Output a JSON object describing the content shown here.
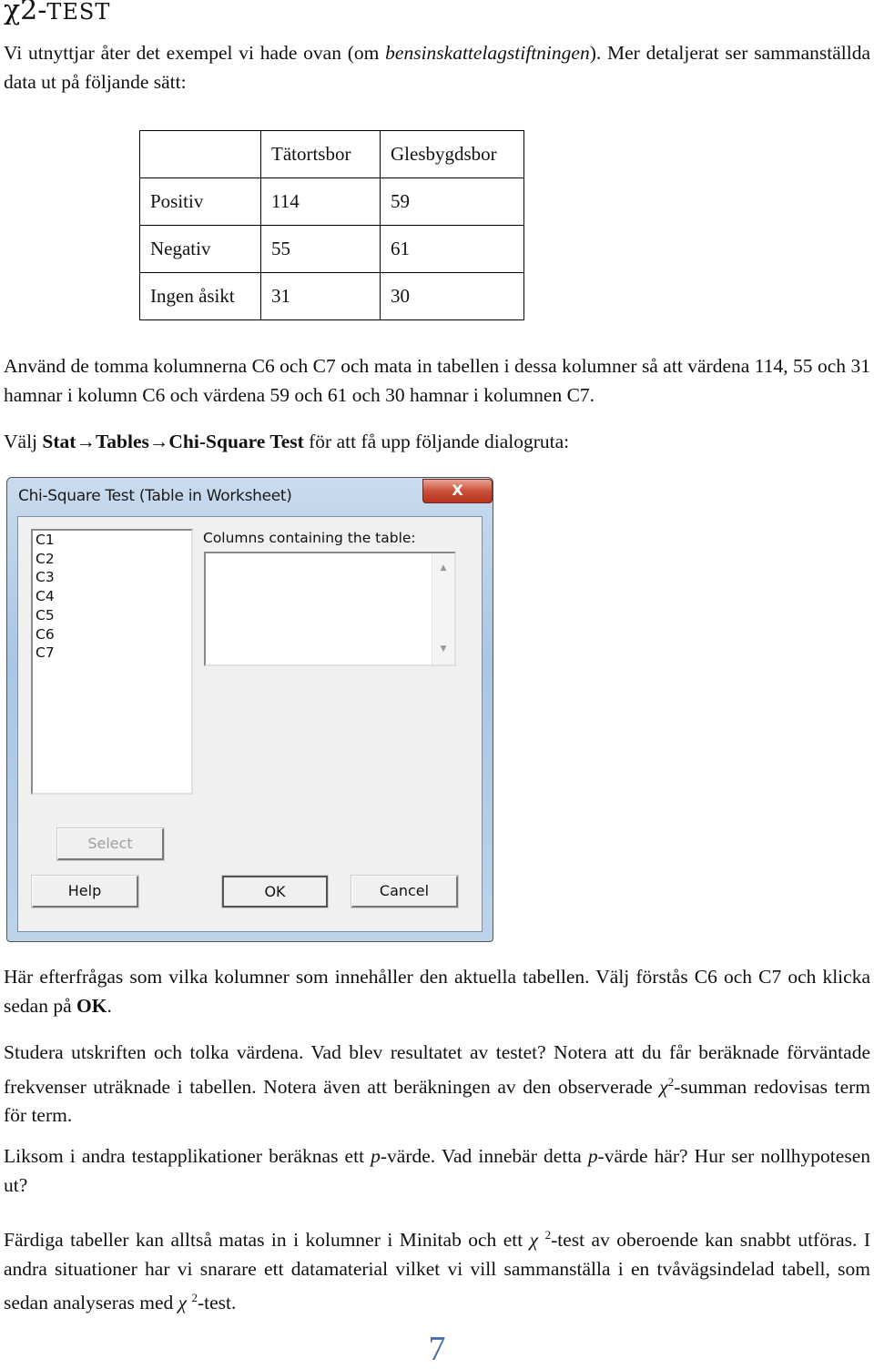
{
  "heading": {
    "chi": "χ2-",
    "word": "TEST"
  },
  "para1": {
    "before": "Vi utnyttjar åter det exempel vi hade ovan (om ",
    "italic": "bensinskattelagstiftningen",
    "after": "). Mer detaljerat ser sammanställda data ut på följande sätt:"
  },
  "table": {
    "headers": [
      "",
      "Tätortsbor",
      "Glesbygdsbor"
    ],
    "rows": [
      [
        "Positiv",
        "114",
        "59"
      ],
      [
        "Negativ",
        "55",
        "61"
      ],
      [
        "Ingen åsikt",
        "31",
        "30"
      ]
    ]
  },
  "para2": "Använd de tomma kolumnerna C6 och C7 och mata in tabellen i dessa kolumner så att värdena 114, 55 och 31 hamnar i kolumn C6 och värdena 59 och 61 och 30 hamnar i kolumnen C7.",
  "para3": {
    "before": "Välj ",
    "menu1": "Stat",
    "arrow": "→",
    "menu2": "Tables",
    "menu3": "Chi-Square Test",
    "after": " för att få upp följande dialogruta:"
  },
  "dialog": {
    "title": "Chi-Square Test (Table in Worksheet)",
    "close": "X",
    "columns": [
      "C1",
      "C2",
      "C3",
      "C4",
      "C5",
      "C6",
      "C7"
    ],
    "columns_label": "Columns containing the table:",
    "columns_value": "",
    "select": "Select",
    "help": "Help",
    "ok": "OK",
    "cancel": "Cancel"
  },
  "para4": {
    "before": "Här efterfrågas som vilka kolumner som innehåller den aktuella tabellen. Välj förstås C6 och C7 och klicka sedan på ",
    "bold": "OK",
    "after": "."
  },
  "para5": {
    "text": "Studera utskriften och tolka värdena. Vad blev resultatet av testet? Notera att du får beräknade förväntade frekvenser uträknade i tabellen. Notera även att beräkningen av den observerade ",
    "chi": "χ",
    "sup": "2",
    "after": "-summan redovisas term för term."
  },
  "para6": {
    "a": "Liksom i andra testapplikationer beräknas ett ",
    "p1": "p",
    "b": "-värde. Vad innebär detta ",
    "p2": "p",
    "c": "-värde här? Hur ser nollhypotesen ut?"
  },
  "para7": {
    "a": "Färdiga tabeller kan alltså matas in i kolumner i Minitab och ett ",
    "chi1": "χ",
    "sup1": "2",
    "b": "-test av oberoende kan snabbt utföras. I andra situationer har vi snarare ett datamaterial vilket vi vill sammanställa i en tvåvägsindelad tabell, som sedan analyseras med ",
    "chi2": "χ",
    "sup2": "2",
    "c": "-test."
  },
  "page_number": "7"
}
